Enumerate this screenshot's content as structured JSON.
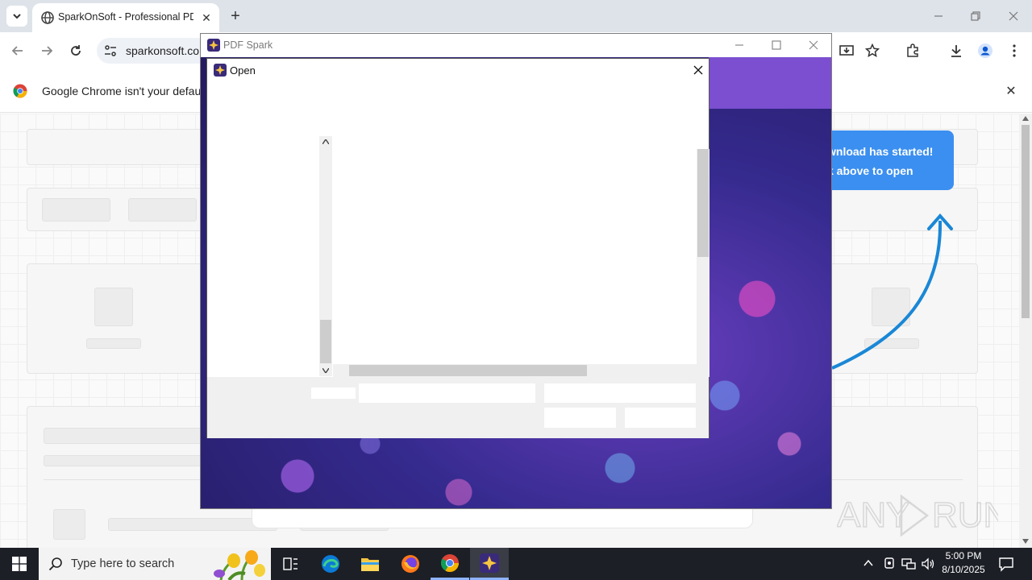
{
  "browser": {
    "tab_title": "SparkOnSoft - Professional PDF",
    "tab_close": "✕",
    "new_tab": "+",
    "address": "sparkonsoft.co",
    "infobar_text": "Google Chrome isn't your default b",
    "infobar_close": "✕",
    "download_callout_line1": "wnload has started!",
    "download_callout_line2": "k above to open"
  },
  "pdf_app": {
    "window_title": "PDF Spark"
  },
  "dialog": {
    "title": "Open",
    "close": "✕"
  },
  "taskbar": {
    "search_placeholder": "Type here to search",
    "time": "5:00 PM",
    "date": "8/10/2025"
  },
  "watermark": "ANY RUN",
  "colors": {
    "callout_blue": "#3b8ff0",
    "arrow_blue": "#1a87d6",
    "app_purple": "#7b4fd0"
  }
}
